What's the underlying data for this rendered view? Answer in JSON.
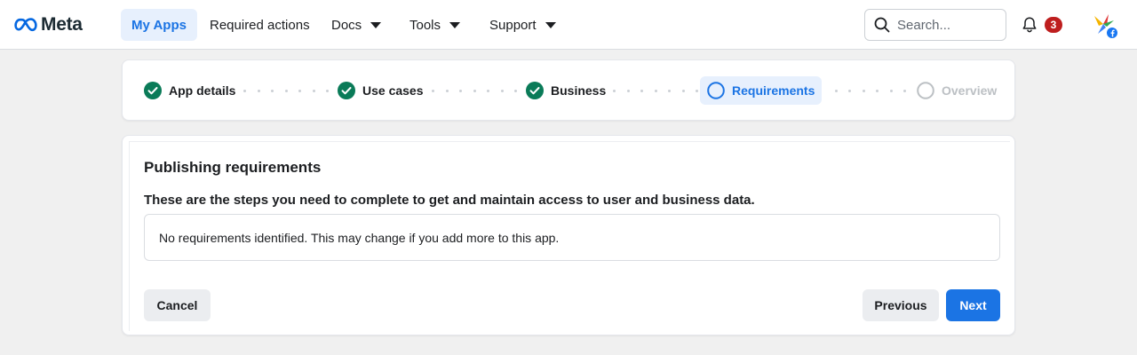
{
  "brand": {
    "name": "Meta"
  },
  "nav": {
    "items": [
      {
        "label": "My Apps"
      },
      {
        "label": "Required actions"
      },
      {
        "label": "Docs"
      },
      {
        "label": "Tools"
      },
      {
        "label": "Support"
      }
    ]
  },
  "search": {
    "placeholder": "Search..."
  },
  "notifications": {
    "count": "3"
  },
  "stepper": {
    "steps": [
      {
        "label": "App details",
        "state": "complete"
      },
      {
        "label": "Use cases",
        "state": "complete"
      },
      {
        "label": "Business",
        "state": "complete"
      },
      {
        "label": "Requirements",
        "state": "current"
      },
      {
        "label": "Overview",
        "state": "upcoming"
      }
    ]
  },
  "requirements": {
    "title": "Publishing requirements",
    "subtitle": "These are the steps you need to complete to get and maintain access to user and business data.",
    "message": "No requirements identified. This may change if you add more to this app."
  },
  "actions": {
    "cancel_label": "Cancel",
    "previous_label": "Previous",
    "next_label": "Next"
  },
  "colors": {
    "accent": "#1b74e4",
    "complete": "#0a7b58",
    "badge": "#be1e1e",
    "upcoming": "#bcc0c4"
  },
  "icons": {
    "logo": "meta-infinity-icon",
    "caret": "chevron-down-icon",
    "search": "search-icon",
    "bell": "bell-icon",
    "avatar": "app-avatar-icon",
    "complete": "check-circle-icon",
    "current": "circle-outline-icon"
  }
}
